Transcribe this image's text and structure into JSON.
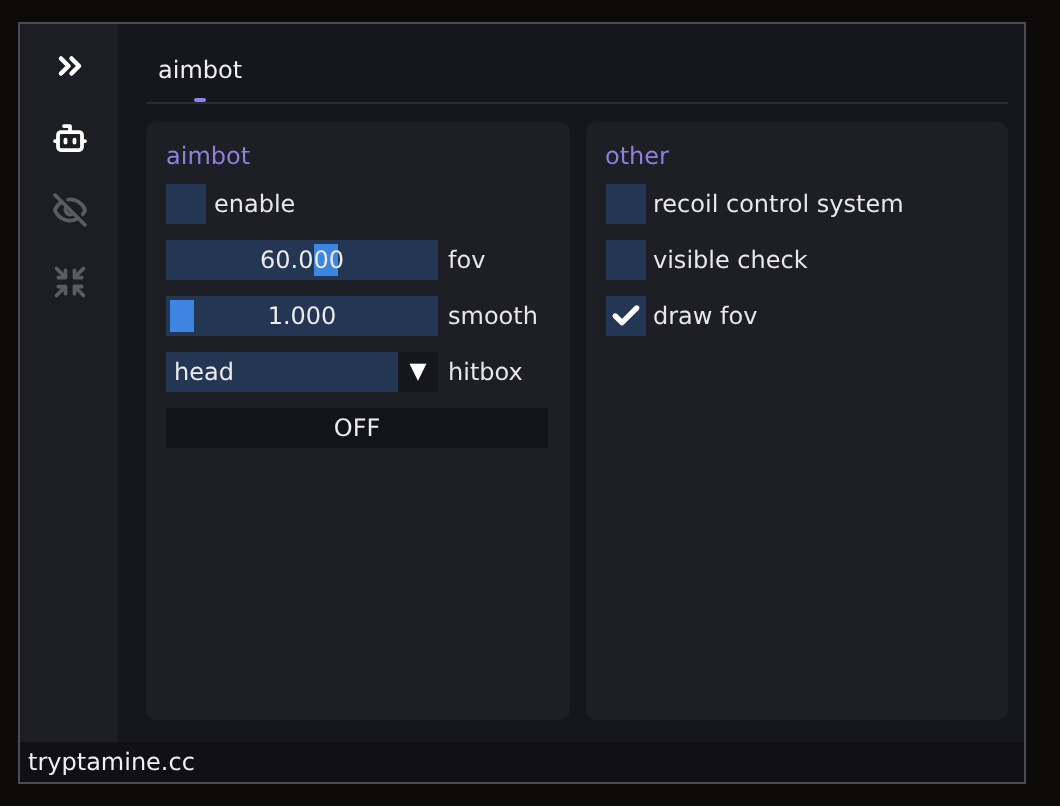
{
  "sidebar": {
    "items": [
      {
        "kind": "robot",
        "selected": true
      },
      {
        "kind": "eye-off",
        "selected": false
      },
      {
        "kind": "shrink",
        "selected": false
      }
    ]
  },
  "tabs": [
    {
      "label": "aimbot",
      "selected": true
    }
  ],
  "panels": [
    {
      "title": "aimbot",
      "controls": [
        {
          "kind": "checkbox",
          "label": "enable",
          "checked": false
        },
        {
          "kind": "slider",
          "label": "fov",
          "reading": "60.000",
          "level": 0.6
        },
        {
          "kind": "slider",
          "label": "smooth",
          "reading": "1.000",
          "level": 0
        },
        {
          "kind": "dropdown",
          "label": "hitbox",
          "value": "head",
          "arrow": "▼"
        },
        {
          "kind": "button",
          "label": "OFF"
        }
      ]
    },
    {
      "title": "other",
      "controls": [
        {
          "kind": "checkbox",
          "label": "recoil control system",
          "checked": false
        },
        {
          "kind": "checkbox",
          "label": "visible check",
          "checked": false
        },
        {
          "kind": "checkbox",
          "label": "draw fov",
          "checked": true
        }
      ]
    }
  ],
  "status_bar": {
    "text": "tryptamine.cc"
  }
}
